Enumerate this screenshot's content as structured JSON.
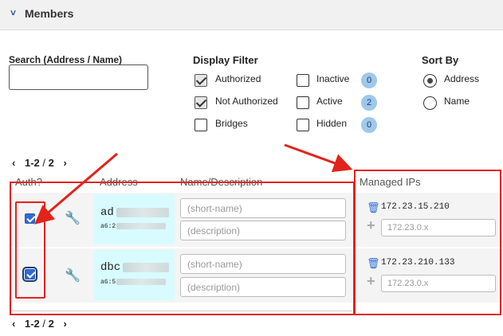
{
  "header": {
    "title": "Members"
  },
  "search": {
    "label": "Search (Address / Name)",
    "value": ""
  },
  "display_filter": {
    "title": "Display Filter",
    "options": [
      {
        "label": "Authorized",
        "checked": true
      },
      {
        "label": "Not Authorized",
        "checked": true
      },
      {
        "label": "Bridges",
        "checked": false
      }
    ],
    "status": [
      {
        "label": "Inactive",
        "checked": false,
        "count": "0"
      },
      {
        "label": "Active",
        "checked": false,
        "count": "2"
      },
      {
        "label": "Hidden",
        "checked": false,
        "count": "0"
      }
    ]
  },
  "sort_by": {
    "title": "Sort By",
    "options": [
      {
        "label": "Address",
        "selected": true
      },
      {
        "label": "Name",
        "selected": false
      }
    ]
  },
  "pager": {
    "range": "1-2",
    "separator": "/",
    "total": "2"
  },
  "columns": {
    "auth": "Auth?",
    "address": "Address",
    "name": "Name/Description",
    "managed_ips": "Managed IPs"
  },
  "members": [
    {
      "authorized": true,
      "address_prefix": "ad",
      "mac_prefix": "a6:2",
      "name_placeholder": "(short-name)",
      "description_placeholder": "(description)",
      "ip": "172.23.15.210",
      "ip_placeholder": "172.23.0.x"
    },
    {
      "authorized": true,
      "address_prefix": "dbc",
      "mac_prefix": "a6:5",
      "name_placeholder": "(short-name)",
      "description_placeholder": "(description)",
      "ip": "172.23.210.133",
      "ip_placeholder": "172.23.0.x"
    }
  ],
  "icons": {
    "collapse": "chevron-down-icon",
    "page_prev": "chevron-left-icon",
    "page_next": "chevron-right-icon",
    "settings": "wrench-icon",
    "delete_ip": "trash-icon",
    "add_ip": "plus-icon"
  },
  "colors": {
    "annotation": "#e2231a",
    "address_highlight": "#d8fbff",
    "authorized_bar": "#35a94c",
    "checkbox": "#2f6bd6",
    "badge": "#9fc8ea"
  }
}
